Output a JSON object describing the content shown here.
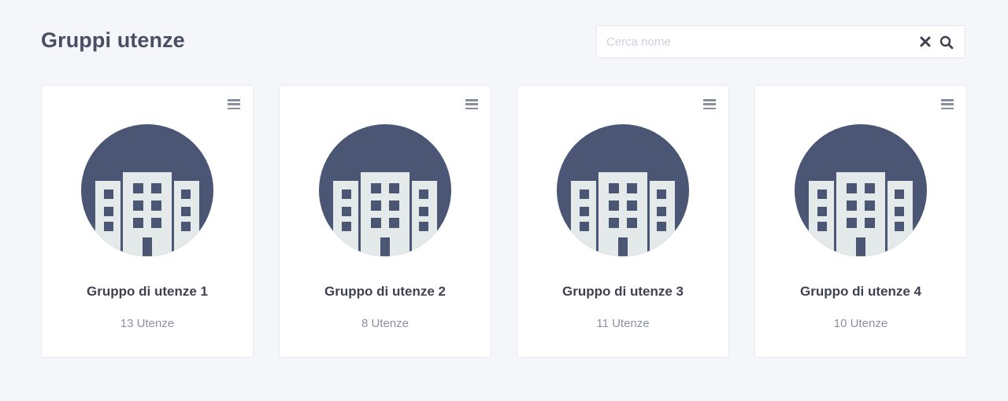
{
  "header": {
    "title": "Gruppi utenze"
  },
  "search": {
    "placeholder": "Cerca nome",
    "value": "",
    "clear_icon": "close-icon",
    "search_icon": "search-icon"
  },
  "colors": {
    "background": "#f5f6fa",
    "avatar_bg": "#4a5674",
    "building": "#e4e9ea",
    "title_text": "#4a4e63",
    "muted_text": "#8c90a2"
  },
  "groups": [
    {
      "name": "Gruppo di utenze 1",
      "count": "13 Utenze",
      "icon": "building-icon",
      "menu_icon": "menu-icon"
    },
    {
      "name": "Gruppo di utenze 2",
      "count": "8 Utenze",
      "icon": "building-icon",
      "menu_icon": "menu-icon"
    },
    {
      "name": "Gruppo di utenze 3",
      "count": "11 Utenze",
      "icon": "building-icon",
      "menu_icon": "menu-icon"
    },
    {
      "name": "Gruppo di utenze 4",
      "count": "10 Utenze",
      "icon": "building-icon",
      "menu_icon": "menu-icon"
    }
  ]
}
